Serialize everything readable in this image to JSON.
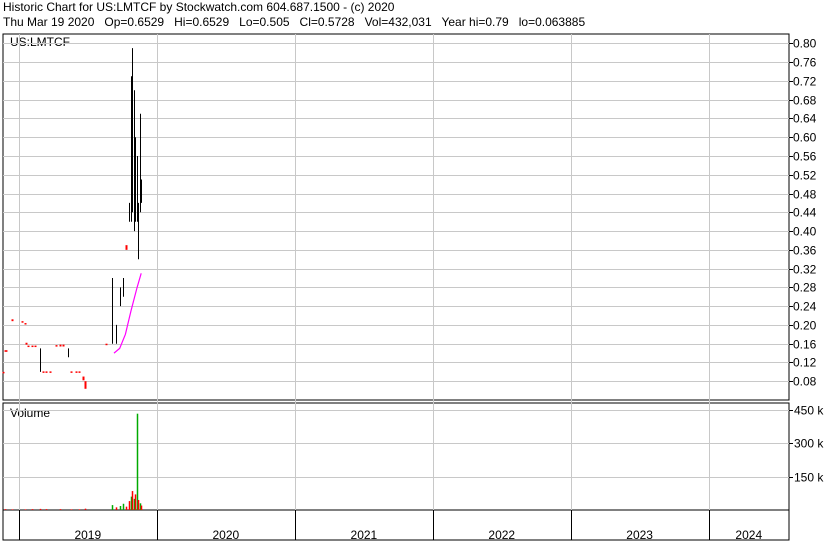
{
  "header": {
    "line1": "Historic Chart for US:LMTCF by Stockwatch.com 604.687.1500 - (c) 2020",
    "line2": "Thu Mar 19 2020   Op=0.6529   Hi=0.6529   Lo=0.505   Cl=0.5728   Vol=432,031   Year hi=0.79   lo=0.063885"
  },
  "chart_data": {
    "type": "candlestick",
    "symbol_label": "US:LMTCF",
    "volume_label": "Volume",
    "price_axis": {
      "ylim": [
        0.04,
        0.82
      ],
      "ticks": [
        "0.08",
        "0.12",
        "0.16",
        "0.20",
        "0.24",
        "0.28",
        "0.32",
        "0.36",
        "0.40",
        "0.44",
        "0.48",
        "0.52",
        "0.56",
        "0.60",
        "0.64",
        "0.68",
        "0.72",
        "0.76",
        "0.80"
      ],
      "tick_values": [
        0.08,
        0.12,
        0.16,
        0.2,
        0.24,
        0.28,
        0.32,
        0.36,
        0.4,
        0.44,
        0.48,
        0.52,
        0.56,
        0.6,
        0.64,
        0.68,
        0.72,
        0.76,
        0.8
      ]
    },
    "volume_axis": {
      "ylim": [
        0,
        480000
      ],
      "ticks": [
        "150 k",
        "300 k",
        "450 k"
      ],
      "tick_values": [
        150000,
        300000,
        450000
      ]
    },
    "x_axis": {
      "range": [
        "2018-11-20",
        "2024-08-01"
      ],
      "years": [
        {
          "label": "2019",
          "start": "2019-01-01"
        },
        {
          "label": "2020",
          "start": "2020-01-01"
        },
        {
          "label": "2021",
          "start": "2021-01-01"
        },
        {
          "label": "2022",
          "start": "2022-01-01"
        },
        {
          "label": "2023",
          "start": "2023-01-01"
        },
        {
          "label": "2024",
          "start": "2024-01-01"
        }
      ]
    },
    "price_bars": [
      {
        "date": "2018-11-21",
        "hi": 0.1,
        "lo": 0.098,
        "color": "red"
      },
      {
        "date": "2018-11-25",
        "hi": 0.146,
        "lo": 0.143,
        "color": "red"
      },
      {
        "date": "2018-11-29",
        "hi": 0.146,
        "lo": 0.143,
        "color": "red"
      },
      {
        "date": "2018-12-15",
        "hi": 0.212,
        "lo": 0.208,
        "color": "red"
      },
      {
        "date": "2019-01-10",
        "hi": 0.208,
        "lo": 0.205,
        "color": "red"
      },
      {
        "date": "2019-01-16",
        "hi": 0.204,
        "lo": 0.201,
        "color": "red"
      },
      {
        "date": "2019-01-20",
        "hi": 0.162,
        "lo": 0.158,
        "color": "red"
      },
      {
        "date": "2019-01-26",
        "hi": 0.156,
        "lo": 0.153,
        "color": "red"
      },
      {
        "date": "2019-02-05",
        "hi": 0.156,
        "lo": 0.153,
        "color": "red"
      },
      {
        "date": "2019-02-12",
        "hi": 0.156,
        "lo": 0.153,
        "color": "red"
      },
      {
        "date": "2019-02-25",
        "hi": 0.15,
        "lo": 0.1,
        "color": "black"
      },
      {
        "date": "2019-03-05",
        "hi": 0.101,
        "lo": 0.098,
        "color": "red"
      },
      {
        "date": "2019-03-15",
        "hi": 0.101,
        "lo": 0.098,
        "color": "red"
      },
      {
        "date": "2019-03-25",
        "hi": 0.101,
        "lo": 0.098,
        "color": "red"
      },
      {
        "date": "2019-04-08",
        "hi": 0.157,
        "lo": 0.154,
        "color": "red"
      },
      {
        "date": "2019-04-20",
        "hi": 0.158,
        "lo": 0.154,
        "color": "red"
      },
      {
        "date": "2019-04-28",
        "hi": 0.158,
        "lo": 0.154,
        "color": "red"
      },
      {
        "date": "2019-05-10",
        "hi": 0.15,
        "lo": 0.131,
        "color": "black"
      },
      {
        "date": "2019-05-20",
        "hi": 0.101,
        "lo": 0.098,
        "color": "red"
      },
      {
        "date": "2019-06-01",
        "hi": 0.101,
        "lo": 0.098,
        "color": "red"
      },
      {
        "date": "2019-06-10",
        "hi": 0.101,
        "lo": 0.098,
        "color": "red"
      },
      {
        "date": "2019-06-20",
        "hi": 0.09,
        "lo": 0.082,
        "color": "red"
      },
      {
        "date": "2019-06-24",
        "hi": 0.08,
        "lo": 0.063885,
        "color": "red"
      },
      {
        "date": "2019-08-20",
        "hi": 0.16,
        "lo": 0.158,
        "color": "red"
      },
      {
        "date": "2019-09-05",
        "hi": 0.3,
        "lo": 0.16,
        "color": "black"
      },
      {
        "date": "2019-09-15",
        "hi": 0.2,
        "lo": 0.16,
        "color": "black"
      },
      {
        "date": "2019-09-25",
        "hi": 0.28,
        "lo": 0.24,
        "color": "black"
      },
      {
        "date": "2019-10-03",
        "hi": 0.3,
        "lo": 0.26,
        "color": "black"
      },
      {
        "date": "2019-10-12",
        "hi": 0.37,
        "lo": 0.36,
        "color": "red"
      },
      {
        "date": "2019-10-20",
        "hi": 0.46,
        "lo": 0.42,
        "color": "black"
      },
      {
        "date": "2019-10-24",
        "hi": 0.73,
        "lo": 0.42,
        "color": "black"
      },
      {
        "date": "2019-10-28",
        "hi": 0.79,
        "lo": 0.44,
        "color": "black"
      },
      {
        "date": "2019-11-01",
        "hi": 0.7,
        "lo": 0.4,
        "color": "black"
      },
      {
        "date": "2019-11-05",
        "hi": 0.6,
        "lo": 0.42,
        "color": "black"
      },
      {
        "date": "2019-11-09",
        "hi": 0.56,
        "lo": 0.42,
        "color": "black"
      },
      {
        "date": "2019-11-13",
        "hi": 0.46,
        "lo": 0.34,
        "color": "black"
      },
      {
        "date": "2019-11-17",
        "hi": 0.65,
        "lo": 0.44,
        "color": "black"
      },
      {
        "date": "2019-11-21",
        "hi": 0.51,
        "lo": 0.46,
        "color": "black"
      }
    ],
    "moving_average": {
      "color": "magenta",
      "points": [
        {
          "date": "2019-09-10",
          "y": 0.14
        },
        {
          "date": "2019-09-25",
          "y": 0.15
        },
        {
          "date": "2019-10-10",
          "y": 0.18
        },
        {
          "date": "2019-10-25",
          "y": 0.23
        },
        {
          "date": "2019-11-10",
          "y": 0.28
        },
        {
          "date": "2019-11-21",
          "y": 0.31
        }
      ]
    },
    "volume_bars": [
      {
        "date": "2018-11-25",
        "value": 4000,
        "color": "red"
      },
      {
        "date": "2018-12-15",
        "value": 3000,
        "color": "red"
      },
      {
        "date": "2019-01-16",
        "value": 3000,
        "color": "red"
      },
      {
        "date": "2019-02-05",
        "value": 4000,
        "color": "red"
      },
      {
        "date": "2019-02-25",
        "value": 5000,
        "color": "red"
      },
      {
        "date": "2019-03-15",
        "value": 4000,
        "color": "red"
      },
      {
        "date": "2019-04-20",
        "value": 4000,
        "color": "red"
      },
      {
        "date": "2019-05-20",
        "value": 3000,
        "color": "red"
      },
      {
        "date": "2019-06-10",
        "value": 3000,
        "color": "red"
      },
      {
        "date": "2019-06-24",
        "value": 6000,
        "color": "red"
      },
      {
        "date": "2019-09-05",
        "value": 22000,
        "color": "green"
      },
      {
        "date": "2019-09-15",
        "value": 12000,
        "color": "red"
      },
      {
        "date": "2019-09-25",
        "value": 18000,
        "color": "green"
      },
      {
        "date": "2019-10-03",
        "value": 28000,
        "color": "green"
      },
      {
        "date": "2019-10-12",
        "value": 15000,
        "color": "red"
      },
      {
        "date": "2019-10-20",
        "value": 40000,
        "color": "red"
      },
      {
        "date": "2019-10-24",
        "value": 60000,
        "color": "green"
      },
      {
        "date": "2019-10-28",
        "value": 85000,
        "color": "red"
      },
      {
        "date": "2019-11-01",
        "value": 50000,
        "color": "green"
      },
      {
        "date": "2019-11-05",
        "value": 70000,
        "color": "red"
      },
      {
        "date": "2019-11-09",
        "value": 432031,
        "color": "green"
      },
      {
        "date": "2019-11-13",
        "value": 45000,
        "color": "red"
      },
      {
        "date": "2019-11-17",
        "value": 30000,
        "color": "green"
      },
      {
        "date": "2019-11-21",
        "value": 20000,
        "color": "red"
      }
    ],
    "grid": true,
    "colors": {
      "up": "#000000",
      "down": "#ff0000",
      "volume_up": "#00aa00",
      "volume_down": "#ff0000",
      "ma": "#ff00ff",
      "grid": "#c8c8c8"
    }
  }
}
